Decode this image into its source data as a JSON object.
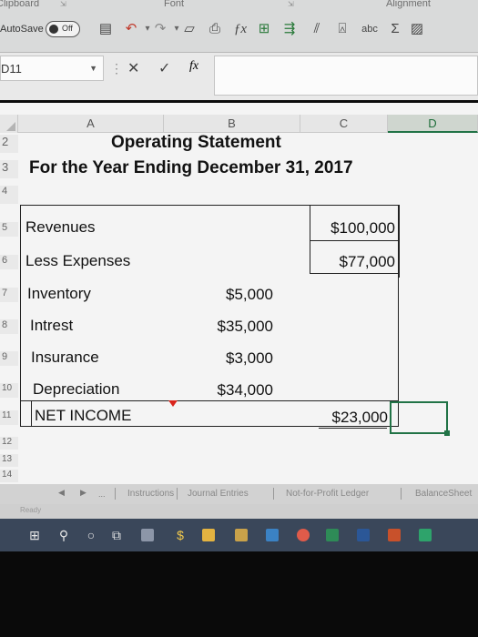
{
  "ribbon": {
    "group_labels": [
      "Clipboard",
      "Font",
      "Alignment"
    ],
    "autosave_label": "AutoSave",
    "autosave_state": "Off",
    "icons": [
      "save-icon",
      "undo-icon",
      "redo-icon",
      "open-icon",
      "print-preview-icon",
      "insert-function-icon",
      "table-icon",
      "sort-icon",
      "filter-icon",
      "accept-icon",
      "spelling-icon",
      "autosum-icon",
      "format-icon"
    ]
  },
  "formula_bar": {
    "name_box": "D11",
    "fx": "fx",
    "cancel": "✕",
    "confirm": "✓",
    "formula_value": ""
  },
  "grid": {
    "columns": [
      "A",
      "B",
      "C",
      "D"
    ],
    "active_column": "D",
    "rows": [
      "2",
      "3",
      "4",
      "5",
      "6",
      "7",
      "8",
      "9",
      "10",
      "11",
      "12",
      "13",
      "14"
    ],
    "active_cell": "D11"
  },
  "statement": {
    "title": "Operating Statement",
    "subtitle": "For the Year Ending December 31, 2017",
    "lines": [
      {
        "row": "5",
        "label": "Revenues",
        "b": "",
        "c": "$100,000"
      },
      {
        "row": "6",
        "label": "Less Expenses",
        "b": "",
        "c": "$77,000"
      },
      {
        "row": "7",
        "label": "Inventory",
        "b": "$5,000",
        "c": ""
      },
      {
        "row": "8",
        "label": "Intrest",
        "b": "$35,000",
        "c": ""
      },
      {
        "row": "9",
        "label": "Insurance",
        "b": "$3,000",
        "c": ""
      },
      {
        "row": "10",
        "label": "Depreciation",
        "b": "$34,000",
        "c": ""
      },
      {
        "row": "11",
        "label": "NET INCOME",
        "b": "",
        "c": "$23,000"
      }
    ]
  },
  "sheet_tabs": [
    "Instructions",
    "Journal Entries",
    "Not-for-Profit Ledger",
    "BalanceSheet"
  ],
  "tab_nav": [
    "◀",
    "▶",
    "..."
  ],
  "status": "Ready",
  "colors": {
    "ribbon_bg": "#d9dada",
    "grid_bg": "#f4f4f4",
    "excel_green": "#217346",
    "taskbar": "#3a475a",
    "comment_red": "#d9251c"
  }
}
